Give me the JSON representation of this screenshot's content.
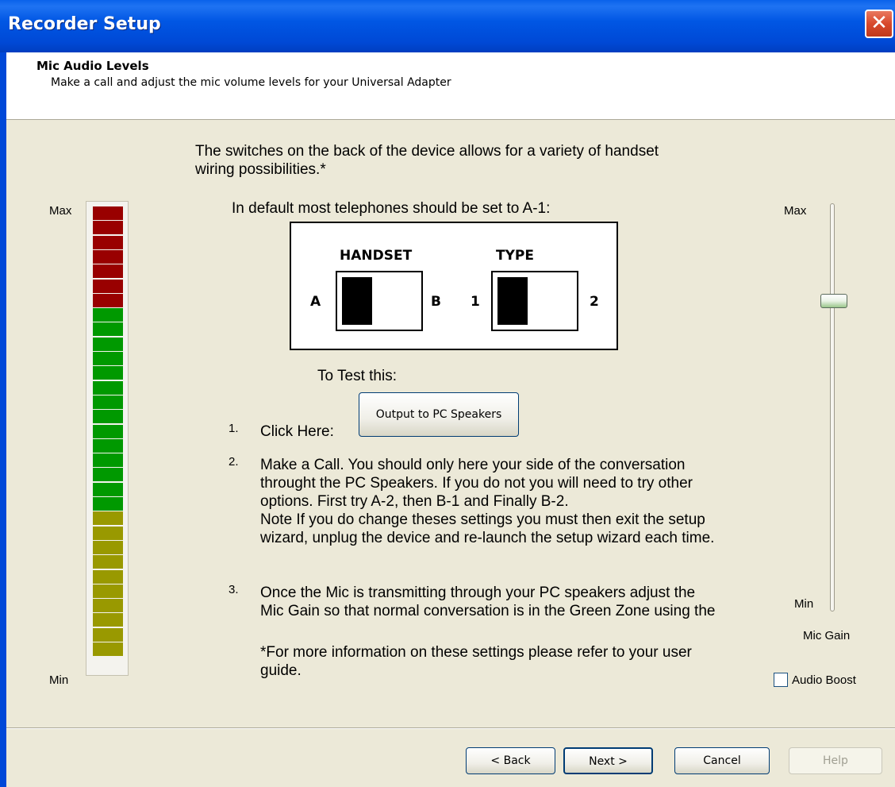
{
  "window": {
    "title": "Recorder Setup",
    "close_glyph": "✕"
  },
  "header": {
    "title": "Mic Audio Levels",
    "subtitle": "Make a call and adjust the mic volume levels for your Universal Adapter"
  },
  "intro": {
    "line1": "The switches on the back of the device allows for a variety of handset",
    "line2": "wiring possibilities.*",
    "default_line": "In default most telephones should be set to A-1:"
  },
  "diagram": {
    "handset_label": "HANDSET",
    "type_label": "TYPE",
    "pos_a": "A",
    "pos_b": "B",
    "pos_1": "1",
    "pos_2": "2"
  },
  "test": {
    "heading": "To Test this:",
    "step1_num": "1.",
    "step1_text": "Click Here:",
    "output_button": "Output to PC Speakers",
    "step2_num": "2.",
    "step2_lines": [
      "Make a Call. You should only here your side of the conversation",
      "throught the PC Speakers. If you do not you will need to try other",
      "options. First try A-2, then B-1 and Finally B-2.",
      "Note If you do change theses settings you must then exit the setup",
      "wizard, unplug the device and re-launch the setup wizard each time."
    ],
    "step3_num": "3.",
    "step3_lines": [
      "Once the Mic is transmitting through your PC speakers adjust the",
      "Mic Gain so that normal conversation is in the Green Zone using the"
    ],
    "footnote_lines": [
      "*For more information on these settings please refer to your user",
      "guide."
    ]
  },
  "meter": {
    "max_label": "Max",
    "min_label": "Min",
    "segments_red": 7,
    "segments_green": 14,
    "segments_olive": 10,
    "colors": {
      "red": "#990000",
      "green": "#009900",
      "olive": "#999900"
    }
  },
  "mic_gain": {
    "max_label": "Max",
    "min_label": "Min",
    "label": "Mic Gain",
    "level": 0.77
  },
  "audio_boost": {
    "label": "Audio Boost",
    "checked": false
  },
  "footer": {
    "back_label": "< Back",
    "next_label": "Next >",
    "cancel_label": "Cancel",
    "help_label": "Help"
  },
  "icons": {
    "close": "close-icon"
  },
  "colors": {
    "titlebar": "#0054e3",
    "dialog_bg": "#ece9d8"
  }
}
